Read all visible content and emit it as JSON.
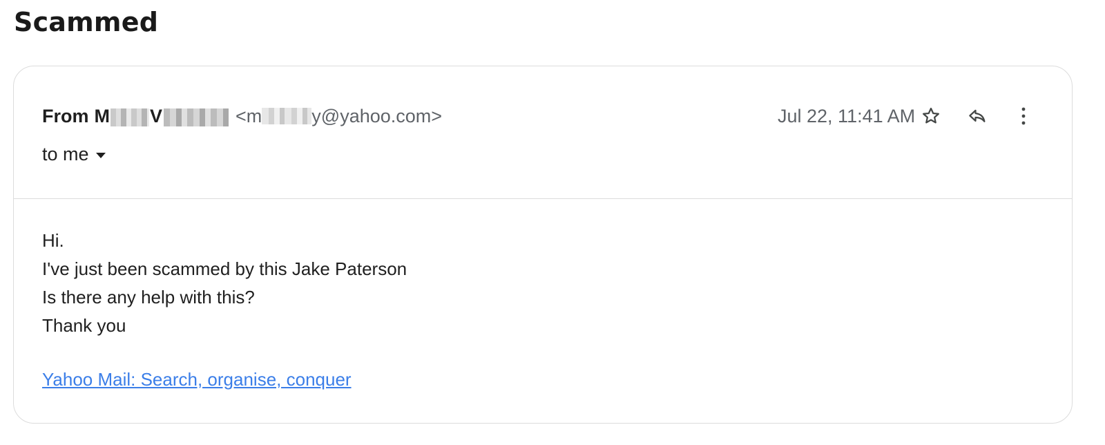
{
  "subject": "Scammed",
  "header": {
    "from_label": "From",
    "sender_first_initial": "M",
    "sender_last_initial": "V",
    "email_open": "<m",
    "email_rest": "y@yahoo.com>",
    "recipient": "to me",
    "date": "Jul 22, 11:41 AM",
    "icons": [
      "star-icon",
      "reply-icon",
      "more-vert-icon"
    ]
  },
  "body": {
    "lines": [
      "Hi.",
      "I've just been scammed by this Jake Paterson",
      "Is there any help with this?",
      "Thank you"
    ],
    "signature_link": "Yahoo Mail: Search, organise, conquer"
  },
  "colors": {
    "link": "#3b7ee8",
    "muted_text": "#5f6368",
    "border": "#dcdcdc"
  }
}
